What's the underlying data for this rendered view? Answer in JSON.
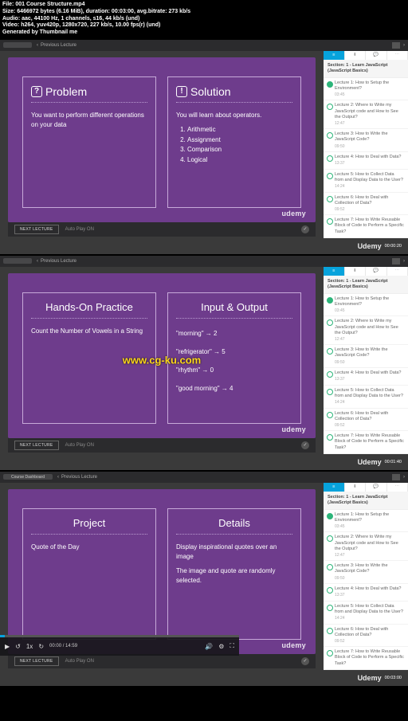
{
  "meta": {
    "l1": "File: 001 Course Structure.mp4",
    "l2": "Size: 6466972 bytes (6.16 MiB), duration: 00:03:00, avg.bitrate: 273 kb/s",
    "l3": "Audio: aac, 44100 Hz, 1 channels, s16, 44 kb/s (und)",
    "l4": "Video: h264, yuv420p, 1280x720, 227 kb/s, 10.00 fps(r) (und)",
    "l5": "Generated by Thumbnail me"
  },
  "top": {
    "prev": "Previous Lecture",
    "dashlbl": "Course Dashboard"
  },
  "bottom": {
    "next": "NEXT LECTURE",
    "auto": "Auto Play ON"
  },
  "ulogo": "udemy",
  "brand": "Udemy",
  "ts": {
    "a": "00:00:20",
    "b": "00:01:40",
    "c": "00:03:00"
  },
  "wm": "www.cg-ku.com",
  "player": {
    "time": "00:00 / 14:59"
  },
  "panel": {
    "section": "Section: 1 - Learn JavaScript (JavaScript Basics)",
    "items": [
      {
        "t": "Lecture 1: How to Setup the Environment?",
        "d": "03:45",
        "done": true
      },
      {
        "t": "Lecture 2: Where to Write my JavaScript code and How to See the Output?",
        "d": "12:47"
      },
      {
        "t": "Lecture 3: How to Write the JavaScript Code?",
        "d": "09:50"
      },
      {
        "t": "Lecture 4: How to Deal with Data?",
        "d": "13:37"
      },
      {
        "t": "Lecture 5: How to Collect Data from and Display Data to the User?",
        "d": "14:24"
      },
      {
        "t": "Lecture 6: How to Deal with Collection of Data?",
        "d": "09:52"
      },
      {
        "t": "Lecture 7: How to Write Reusable Block of Code to Perform a Specific Task?",
        "d": ""
      }
    ]
  },
  "f1": {
    "l": {
      "t": "Problem",
      "b": "You want to perform different operations on your data"
    },
    "r": {
      "t": "Solution",
      "b": "You will learn about operators.",
      "li": [
        "Arithmetic",
        "Assignment",
        "Comparison",
        "Logical"
      ]
    }
  },
  "f2": {
    "l": {
      "t": "Hands-On Practice",
      "b": "Count the Number of Vowels in a String"
    },
    "r": {
      "t": "Input & Output",
      "lines": [
        "\"morning\" → 2",
        "\"refrigerator\" → 5",
        "\"rhythm\" → 0",
        "\"good morning\" → 4"
      ]
    }
  },
  "f3": {
    "l": {
      "t": "Project",
      "b": "Quote of the Day"
    },
    "r": {
      "t": "Details",
      "b1": "Display inspirational quotes over an image",
      "b2": "The image and quote are randomly selected."
    }
  }
}
